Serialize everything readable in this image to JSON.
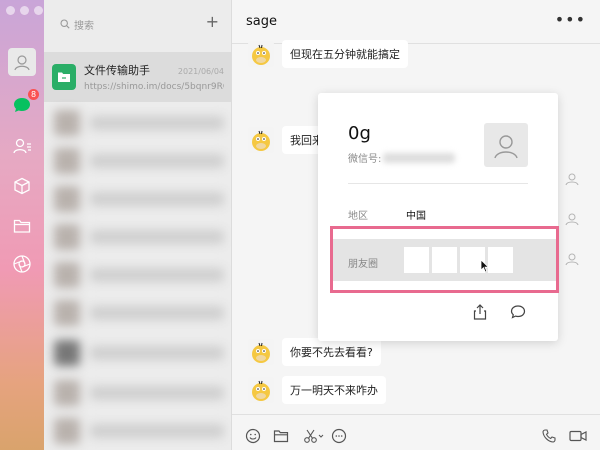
{
  "sidebar": {
    "unread_badge": "8",
    "icons": [
      "avatar-icon",
      "chat-icon",
      "contacts-icon",
      "cube-icon",
      "folder-icon",
      "aperture-icon"
    ]
  },
  "conv_list": {
    "search_placeholder": "搜索",
    "add_label": "+",
    "items": [
      {
        "name": "文件传输助手",
        "date": "2021/06/04",
        "preview": "https://shimo.im/docs/5bqnr9RG..."
      }
    ]
  },
  "chat": {
    "title": "sage",
    "more_label": "•••",
    "messages": [
      {
        "text": "但现在五分钟就能搞定"
      },
      {
        "text": "我回来了"
      },
      {
        "text": "你要不先去看看?"
      },
      {
        "text": "万一明天不来咋办"
      }
    ]
  },
  "profile": {
    "name": "0g",
    "wechat_id_label": "微信号:",
    "region_label": "地区",
    "region_value": "中国",
    "moments_label": "朋友圈"
  },
  "colors": {
    "highlight": "#e86a8f",
    "file_icon": "#2aae67",
    "badge": "#fa5151"
  }
}
